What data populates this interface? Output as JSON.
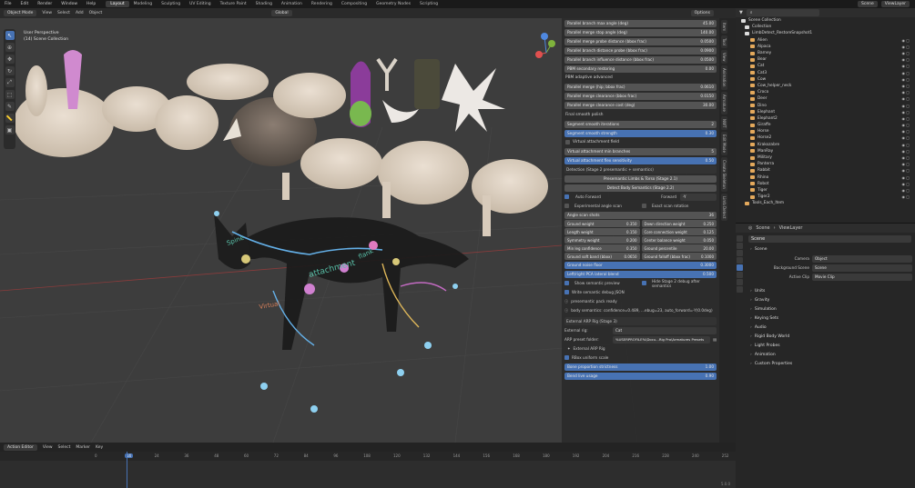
{
  "topbar": {
    "menu": [
      "File",
      "Edit",
      "Render",
      "Window",
      "Help"
    ],
    "workspaces": [
      "Layout",
      "Modeling",
      "Sculpting",
      "UV Editing",
      "Texture Paint",
      "Shading",
      "Animation",
      "Rendering",
      "Compositing",
      "Geometry Nodes",
      "Scripting"
    ],
    "active_workspace": "Layout",
    "scene": "Scene",
    "view_layer": "ViewLayer"
  },
  "viewport_header": {
    "mode": "Object Mode",
    "menus": [
      "View",
      "Select",
      "Add",
      "Object"
    ],
    "orientation": "Global",
    "options": "Options"
  },
  "viewport": {
    "perspective": "User Perspective",
    "collection": "(14) Scene Collection"
  },
  "n_panel": {
    "tabs": [
      "Item",
      "Tool",
      "View",
      "Animation",
      "Armature",
      "NWT",
      "Edit Mode",
      "Create Skeleton",
      "Limb Detect"
    ],
    "top_rows": [
      {
        "label": "Parallel branch max angle (deg)",
        "value": "45.00"
      },
      {
        "label": "Parallel merge stop angle (deg)",
        "value": "140.00"
      },
      {
        "label": "Parallel merge probe distance (bbox frac)",
        "value": "0.0500"
      },
      {
        "label": "Parallel branch distance probe (bbox frac)",
        "value": "0.0900"
      },
      {
        "label": "Parallel branch influence distance (bbox frac)",
        "value": "0.0500"
      },
      {
        "label": "PBM secondary restoring",
        "value": "0.00"
      }
    ],
    "pbm_heading": "PBM adaptive advanced",
    "pbm_rows": [
      {
        "label": "Parallel merge (hip; bbox frac)",
        "value": "0.0610"
      },
      {
        "label": "Parallel merge clearance (bbox frac)",
        "value": "0.0150"
      },
      {
        "label": "Parallel merge clearance cost (deg)",
        "value": "30.00"
      }
    ],
    "smooth_heading": "Final smooth polish",
    "smooth_rows": [
      {
        "label": "Segment smooth iterations",
        "value": "2",
        "style": "grey"
      },
      {
        "label": "Segment smooth strength",
        "value": "0.30",
        "style": "blue"
      }
    ],
    "va_checkbox": "Virtual attachment field",
    "va_rows": [
      {
        "label": "Virtual attachment min branches",
        "value": "5",
        "style": "grey"
      },
      {
        "label": "Virtual attachment flex sensitivity",
        "value": "0.50",
        "style": "blue"
      }
    ],
    "detection_heading": "Detection (Stage 2 presemantic + semantics)",
    "presemantic_button": "Presemantic Limbs & Torso (Stage 2.1)",
    "semantics_button": "Detect Body Semantics (Stage 2.2)",
    "auto_forward": "Auto Forward",
    "forward_label": "Forward",
    "forward_value": "-Y",
    "exp_angle": "Experimental angle scan",
    "exact_scan": "Exact scan rotation",
    "angle_scan_shots": {
      "label": "Angle scan shots",
      "value": "36"
    },
    "weights": [
      {
        "l": "Ground weight",
        "lv": "0.350",
        "r": "Down direction weight",
        "rv": "0.250"
      },
      {
        "l": "Length weight",
        "lv": "0.150",
        "r": "Core connection weight",
        "rv": "0.125"
      },
      {
        "l": "Symmetry weight",
        "lv": "0.200",
        "r": "Center balance weight",
        "rv": "0.050"
      },
      {
        "l": "Min leg confidence",
        "lv": "0.350",
        "r": "Ground percentile",
        "rv": "20.00"
      },
      {
        "l": "Ground soft band (bbox)",
        "lv": "0.0650",
        "r": "Ground falloff (bbox frac)",
        "rv": "0.1000"
      }
    ],
    "ground_noise": {
      "label": "Ground noise floor",
      "value": "0.3000"
    },
    "pca_blend": {
      "label": "Left/right PCA lateral blend",
      "value": "0.500"
    },
    "show_preview": "Show semantic preview",
    "hide_stage2": "Hide Stage 2 debug after semantics",
    "write_debug": "Write semantic debug JSON",
    "pack_ready": "presemantic pack ready",
    "body_semantics": "body semantics: confidence=0.489, ...ebug=23, auto_forward=-Y(0.0deg)",
    "arp_heading": "External ARP Rig (Stage 3)",
    "external_rig_label": "External rig:",
    "external_rig_value": "Cat",
    "arp_folder_label": "ARP preset folder:",
    "arp_folder_value": "%USERPROFILE%\\Docu...Rig Pro\\Armatures Presets",
    "arp_button": "External ARP Rig",
    "rbox_uniform": "RBox uniform scale",
    "bone_proportion": {
      "label": "Bone proportion strictness",
      "value": "1.00"
    },
    "bend_live": {
      "label": "Bend live usage",
      "value": "0.90"
    }
  },
  "viewport_labels": [
    "Spine",
    "attachment",
    "Virtual",
    "flank"
  ],
  "outliner": {
    "root": "Scene Collection",
    "collection": "Collection",
    "snapshot": "LimbDetect_RestoreSnapshot1",
    "items": [
      "Alien",
      "Alpaca",
      "Barney",
      "Bear",
      "Cat",
      "Cat3",
      "Cow",
      "Cow_helper_neck",
      "Croco",
      "Deer",
      "Dino",
      "Elephant",
      "Elephant2",
      "Giraffe",
      "Horse",
      "Horse2",
      "Krakozabre",
      "ManRay",
      "Military",
      "Panterra",
      "Rabbit",
      "Rhino",
      "Robot",
      "Tiger",
      "Tiger2"
    ],
    "trailing": "Tools_Each_Item"
  },
  "properties": {
    "scene_label": "Scene",
    "view_layer": "ViewLayer",
    "scene_name": "Scene",
    "section": "Scene",
    "camera_label": "Camera",
    "camera_value": "Object",
    "bg_label": "Background Scene",
    "bg_value": "Scene",
    "clip_label": "Active Clip",
    "clip_value": "Movie Clip",
    "sections": [
      "Units",
      "Gravity",
      "Simulation",
      "Keying Sets",
      "Audio",
      "Rigid Body World",
      "Light Probes",
      "Animation",
      "Custom Properties"
    ]
  },
  "timeline": {
    "editor": "Action Editor",
    "menus": [
      "View",
      "Select",
      "Marker",
      "Key"
    ],
    "current_frame": "14",
    "ticks": [
      "0",
      "14",
      "24",
      "36",
      "48",
      "60",
      "72",
      "84",
      "96",
      "108",
      "120",
      "132",
      "144",
      "156",
      "168",
      "180",
      "192",
      "204",
      "216",
      "228",
      "240",
      "252"
    ]
  },
  "status": {
    "version": "5.0.0"
  },
  "colors": {
    "accent": "#4772b3",
    "viewport": "#3d3d3d",
    "panel": "#282828"
  }
}
